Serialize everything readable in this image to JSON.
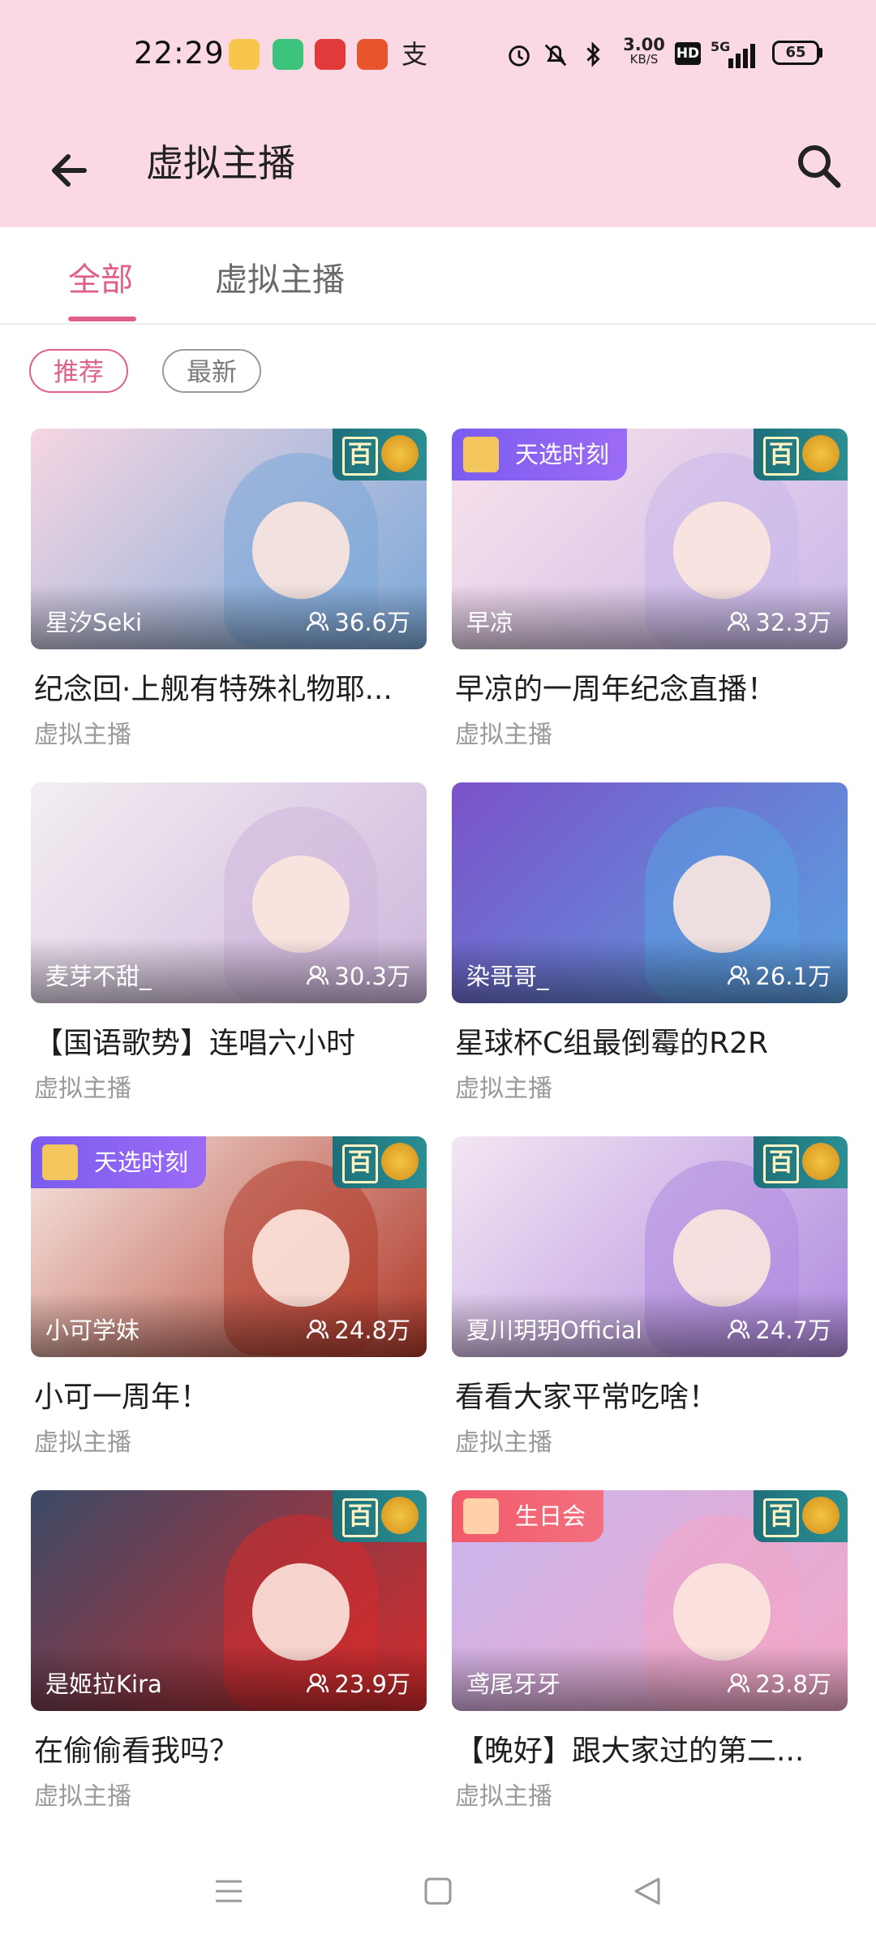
{
  "status_bar": {
    "time": "22:29",
    "net_speed": "3.00",
    "net_unit": "KB/S",
    "hd": "HD",
    "signal": "5G",
    "battery": "65"
  },
  "header": {
    "title": "虚拟主播",
    "back_icon": "arrow-left-icon",
    "search_icon": "search-icon"
  },
  "tabs": [
    {
      "label": "全部",
      "active": true
    },
    {
      "label": "虚拟主播",
      "active": false
    }
  ],
  "filters": [
    {
      "label": "推荐",
      "active": true
    },
    {
      "label": "最新",
      "active": false
    }
  ],
  "cards": [
    {
      "anchor": "星汐Seki",
      "views": "36.6万",
      "title": "纪念回·上舰有特殊礼物耶...",
      "category": "虚拟主播",
      "tag": "",
      "hundred_badge": true,
      "colors": [
        "#f6d6e2",
        "#7aa8d8"
      ]
    },
    {
      "anchor": "早凉",
      "views": "32.3万",
      "title": "早凉的一周年纪念直播！",
      "category": "虚拟主播",
      "tag": "天选时刻",
      "hundred_badge": true,
      "colors": [
        "#fbe3ea",
        "#c9b8ea"
      ]
    },
    {
      "anchor": "麦芽不甜_",
      "views": "30.3万",
      "title": "【国语歌势】连唱六小时",
      "category": "虚拟主播",
      "tag": "",
      "hundred_badge": false,
      "colors": [
        "#f4eef2",
        "#cdb6dc"
      ]
    },
    {
      "anchor": "染哥哥_",
      "views": "26.1万",
      "title": "星球杯C组最倒霉的R2R",
      "category": "虚拟主播",
      "tag": "",
      "hundred_badge": false,
      "colors": [
        "#7b52c8",
        "#5aa0e0"
      ]
    },
    {
      "anchor": "小可学妹",
      "views": "24.8万",
      "title": "小可一周年！",
      "category": "虚拟主播",
      "tag": "天选时刻",
      "hundred_badge": true,
      "colors": [
        "#f7e9e3",
        "#b03a2a"
      ]
    },
    {
      "anchor": "夏川玥玥Official",
      "views": "24.7万",
      "title": "看看大家平常吃啥！",
      "category": "虚拟主播",
      "tag": "",
      "hundred_badge": true,
      "colors": [
        "#f3e6f2",
        "#b08be0"
      ]
    },
    {
      "anchor": "是姬拉Kira",
      "views": "23.9万",
      "title": "在偷偷看我吗？",
      "category": "虚拟主播",
      "tag": "",
      "hundred_badge": true,
      "colors": [
        "#3b4a66",
        "#d62a2a"
      ]
    },
    {
      "anchor": "鸢尾牙牙",
      "views": "23.8万",
      "title": "【晚好】跟大家过的第二...",
      "category": "虚拟主播",
      "tag": "生日会",
      "hundred_badge": true,
      "colors": [
        "#c8b6ef",
        "#f2a6c6"
      ]
    }
  ],
  "bottom_nav": {
    "menu_icon": "menu-icon",
    "home_icon": "home-square-icon",
    "back_icon": "back-triangle-icon"
  }
}
